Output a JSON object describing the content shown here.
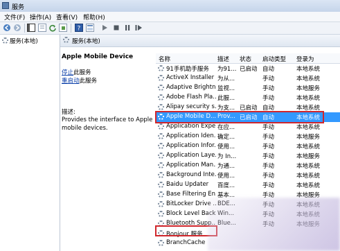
{
  "window": {
    "title": "服务"
  },
  "menu": [
    {
      "label": "文件(F)"
    },
    {
      "label": "操作(A)"
    },
    {
      "label": "查看(V)"
    },
    {
      "label": "帮助(H)"
    }
  ],
  "toolbar": {
    "icons": [
      "back-icon",
      "forward-icon",
      "console-tree-icon",
      "properties-icon",
      "refresh-icon",
      "export-icon",
      "help-icon",
      "view-icon",
      "play-icon",
      "stop-icon",
      "pause-icon",
      "restart-icon"
    ]
  },
  "tree": {
    "item_label": "服务(本地)"
  },
  "main_header": {
    "label": "服务(本地)"
  },
  "detail": {
    "service_name": "Apple Mobile Device",
    "stop_link": "停止",
    "stop_suffix": "此服务",
    "restart_link": "重启动",
    "restart_suffix": "此服务",
    "desc_label": "描述:",
    "desc_text": "Provides the interface to Apple mobile devices."
  },
  "columns": {
    "name": "名称",
    "desc": "描述",
    "status": "状态",
    "startup": "启动类型",
    "logon": "登录为"
  },
  "rows": [
    {
      "name": "91手机助手服务",
      "desc": "为91...",
      "status": "已启动",
      "startup": "自动",
      "logon": "本地系统"
    },
    {
      "name": "ActiveX Installer ...",
      "desc": "为从...",
      "status": "",
      "startup": "手动",
      "logon": "本地系统"
    },
    {
      "name": "Adaptive Brightn...",
      "desc": "监视...",
      "status": "",
      "startup": "手动",
      "logon": "本地服务"
    },
    {
      "name": "Adobe Flash Pla...",
      "desc": "此服...",
      "status": "",
      "startup": "手动",
      "logon": "本地系统"
    },
    {
      "name": "Alipay security s...",
      "desc": "为支...",
      "status": "已启动",
      "startup": "自动",
      "logon": "本地系统"
    },
    {
      "name": "Apple Mobile D...",
      "desc": "Prov...",
      "status": "已启动",
      "startup": "自动",
      "logon": "本地系统"
    },
    {
      "name": "Application Expe...",
      "desc": "在应...",
      "status": "",
      "startup": "手动",
      "logon": "本地系统"
    },
    {
      "name": "Application Iden...",
      "desc": "确定...",
      "status": "",
      "startup": "手动",
      "logon": "本地服务"
    },
    {
      "name": "Application Infor...",
      "desc": "使用...",
      "status": "",
      "startup": "手动",
      "logon": "本地系统"
    },
    {
      "name": "Application Laye...",
      "desc": "为 In...",
      "status": "",
      "startup": "手动",
      "logon": "本地服务"
    },
    {
      "name": "Application Man...",
      "desc": "为通...",
      "status": "",
      "startup": "手动",
      "logon": "本地系统"
    },
    {
      "name": "Background Inte...",
      "desc": "使用...",
      "status": "",
      "startup": "手动",
      "logon": "本地系统"
    },
    {
      "name": "Baidu Updater",
      "desc": "百度...",
      "status": "",
      "startup": "手动",
      "logon": "本地系统"
    },
    {
      "name": "Base Filtering En...",
      "desc": "基本...",
      "status": "",
      "startup": "手动",
      "logon": "本地服务"
    },
    {
      "name": "BitLocker Drive ...",
      "desc": "BDE...",
      "status": "",
      "startup": "手动",
      "logon": "本地系统"
    },
    {
      "name": "Block Level Back...",
      "desc": "Win...",
      "status": "",
      "startup": "手动",
      "logon": "本地系统"
    },
    {
      "name": "Bluetooth Supp...",
      "desc": "Blue...",
      "status": "",
      "startup": "手动",
      "logon": "本地服务"
    },
    {
      "name": "Bonjour 服务",
      "desc": "",
      "status": "",
      "startup": "",
      "logon": ""
    },
    {
      "name": "BranchCache",
      "desc": "",
      "status": "",
      "startup": "",
      "logon": ""
    }
  ],
  "selected_row_index": 5
}
